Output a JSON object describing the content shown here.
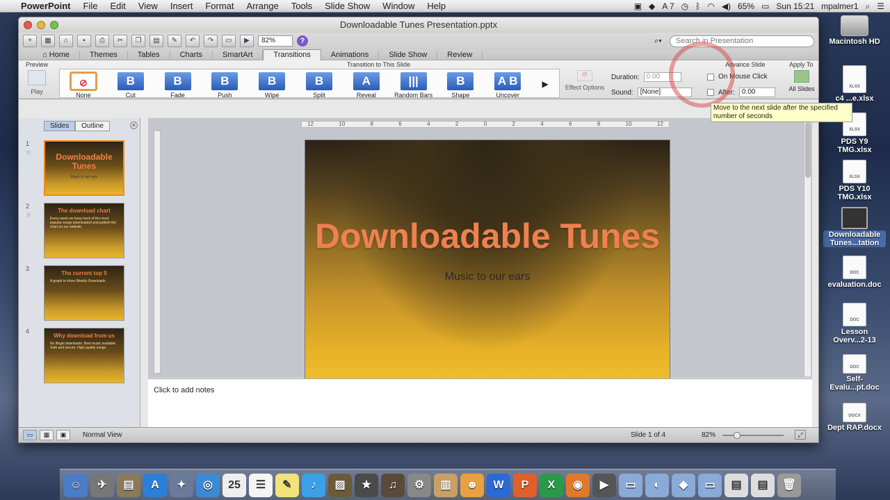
{
  "menubar": {
    "app_name": "PowerPoint",
    "items": [
      "File",
      "Edit",
      "View",
      "Insert",
      "Format",
      "Arrange",
      "Tools",
      "Slide Show",
      "Window",
      "Help"
    ],
    "status": {
      "adobe_count": "7",
      "battery": "65%",
      "clock": "Sun 15:21",
      "user": "mpalmer1"
    }
  },
  "desktop": {
    "icons": [
      {
        "label": "Macintosh HD",
        "kind": "hd"
      },
      {
        "label": "c4 ...e.xlsx",
        "kind": "xlsx"
      },
      {
        "label": "PDS Y9 TMG.xlsx",
        "kind": "xlsx"
      },
      {
        "label": "PDS Y10 TMG.xlsx",
        "kind": "xlsx"
      },
      {
        "label": "Downloadable Tunes...tation",
        "kind": "ppt"
      },
      {
        "label": "evaluation.doc",
        "kind": "doc"
      },
      {
        "label": "Lesson Overv...2-13",
        "kind": "doc"
      },
      {
        "label": "Self-Evalu...pt.doc",
        "kind": "doc"
      },
      {
        "label": "Dept RAP.docx",
        "kind": "docx"
      }
    ]
  },
  "window": {
    "title": "Downloadable Tunes Presentation.pptx",
    "zoom_value": "82%",
    "search_placeholder": "Search in Presentation"
  },
  "ribbon_tabs": [
    "Home",
    "Themes",
    "Tables",
    "Charts",
    "SmartArt",
    "Transitions",
    "Animations",
    "Slide Show",
    "Review"
  ],
  "active_tab": "Transitions",
  "ribbon": {
    "preview_title": "Preview",
    "play_label": "Play",
    "transition_title": "Transition to This Slide",
    "transitions": [
      {
        "label": "None",
        "glyph": "⊘"
      },
      {
        "label": "Cut",
        "glyph": "B"
      },
      {
        "label": "Fade",
        "glyph": "B"
      },
      {
        "label": "Push",
        "glyph": "B"
      },
      {
        "label": "Wipe",
        "glyph": "B"
      },
      {
        "label": "Split",
        "glyph": "B"
      },
      {
        "label": "Reveal",
        "glyph": "A"
      },
      {
        "label": "Random Bars",
        "glyph": "|||"
      },
      {
        "label": "Shape",
        "glyph": "B"
      },
      {
        "label": "Uncover",
        "glyph": "A B"
      }
    ],
    "effect_options_label": "Effect Options",
    "duration_label": "Duration:",
    "duration_value": "0.00",
    "sound_label": "Sound:",
    "sound_value": "[None]",
    "advance_title": "Advance Slide",
    "on_mouse_click_label": "On Mouse Click",
    "after_label": "After:",
    "after_value": "0.00",
    "apply_to_title": "Apply To",
    "all_slides_label": "All Slides",
    "tooltip": "Move to the next slide after the specified number of seconds"
  },
  "left_pane": {
    "slides_tab": "Slides",
    "outline_tab": "Outline",
    "thumbnails": [
      {
        "num": "1",
        "title": "Downloadable Tunes",
        "sub": "Music to our ears"
      },
      {
        "num": "2",
        "title": "The download chart",
        "sub": "Every week we keep track of the most popular songs downloaded and publish the chart on our website."
      },
      {
        "num": "3",
        "title": "The current top 5",
        "sub": "A graph to show Weekly Downloads"
      },
      {
        "num": "4",
        "title": "Why download from us",
        "sub": "No illegal downloads. Best music available. Safe and secure. High quality songs."
      }
    ]
  },
  "ruler_ticks": [
    "12",
    "10",
    "8",
    "6",
    "4",
    "2",
    "0",
    "2",
    "4",
    "6",
    "8",
    "10",
    "12"
  ],
  "slide": {
    "title": "Downloadable Tunes",
    "subtitle": "Music to our ears"
  },
  "notes_placeholder": "Click to add notes",
  "status": {
    "view_name": "Normal View",
    "slide_counter": "Slide 1 of 4",
    "zoom": "82%"
  },
  "colors": {
    "accent_orange": "#f08050",
    "tab_blue": "#b9cdea",
    "tooltip_bg": "#ffffc8"
  }
}
